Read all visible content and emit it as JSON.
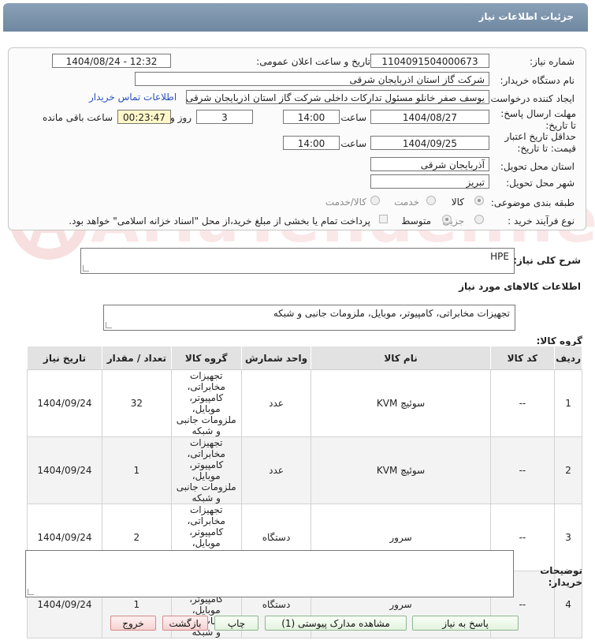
{
  "window": {
    "title": "جزئیات اطلاعات نیاز"
  },
  "watermark": {
    "text": "AriaTender.neT"
  },
  "form": {
    "need_number_label": "شماره نیاز:",
    "need_number": "1104091504000673",
    "announce_label": "تاریخ و ساعت اعلان عمومی:",
    "announce_value": "1404/08/24 - 12:32",
    "buyer_org_label": "نام دستگاه خریدار:",
    "buyer_org": "شرکت گاز استان اذربایجان شرقی",
    "requester_label": "ایجاد کننده درخواست:",
    "requester": "یوسف صفر خانلو  مسئول تدارکات داخلی  شرکت گاز استان اذربایجان شرقی",
    "contact_link": "اطلاعات تماس خریدار",
    "deadline_label": "مهلت ارسال پاسخ: تا تاریخ:",
    "deadline_date": "1404/08/27",
    "time_label": "ساعت",
    "deadline_time": "14:00",
    "days": "3",
    "days_label": "روز و",
    "remaining": "00:23:47",
    "remaining_label": "ساعت باقی مانده",
    "validity_label": "حداقل تاریخ اعتبار قیمت: تا تاریخ:",
    "validity_date": "1404/09/25",
    "validity_time": "14:00",
    "province_label": "استان محل تحویل:",
    "province": "آذربایجان شرقی",
    "city_label": "شهر محل تحویل:",
    "city": "تبریز",
    "category_label": "طبقه بندی موضوعی:",
    "category_options": [
      "کالا",
      "خدمت",
      "کالا/خدمت"
    ],
    "process_label": "نوع فرآیند خرید :",
    "process_options": [
      "جزیی",
      "متوسط"
    ],
    "payment_note": "پرداخت تمام یا بخشی از مبلغ خرید،از محل \"اسناد خزانه اسلامی\" خواهد بود."
  },
  "summary": {
    "label": "شرح کلی نیاز:",
    "value": "HPE"
  },
  "goods": {
    "section_title": "اطلاعات کالاهای مورد نیاز",
    "group_label": "گروه کالا:",
    "group_value": "تجهیزات مخابراتی، کامپیوتر، موبایل، ملزومات جانبی و شبکه"
  },
  "table": {
    "headers": [
      "ردیف",
      "کد کالا",
      "نام کالا",
      "واحد شمارش",
      "گروه کالا",
      "تعداد / مقدار",
      "تاریخ نیاز"
    ],
    "rows": [
      [
        "1",
        "--",
        "سوئیچ KVM",
        "عدد",
        "تجهیزات مخابراتی، کامپیوتر، موبایل، ملزومات جانبی و شبکه",
        "32",
        "1404/09/24"
      ],
      [
        "2",
        "--",
        "سوئیچ KVM",
        "عدد",
        "تجهیزات مخابراتی، کامپیوتر، موبایل، ملزومات جانبی و شبکه",
        "1",
        "1404/09/24"
      ],
      [
        "3",
        "--",
        "سرور",
        "دستگاه",
        "تجهیزات مخابراتی، کامپیوتر، موبایل، ملزومات جانبی و شبکه",
        "2",
        "1404/09/24"
      ],
      [
        "4",
        "--",
        "سرور",
        "دستگاه",
        "تجهیزات مخابراتی، کامپیوتر، موبایل، ملزومات جانبی و شبکه",
        "1",
        "1404/09/24"
      ]
    ]
  },
  "notes": {
    "label": "توضیحات خریدار:",
    "value": ""
  },
  "buttons": {
    "reply": "پاسخ به نیاز",
    "attachments": "مشاهده مدارک پیوستی (1)",
    "print": "چاپ",
    "back": "بازگشت",
    "exit": "خروج"
  }
}
